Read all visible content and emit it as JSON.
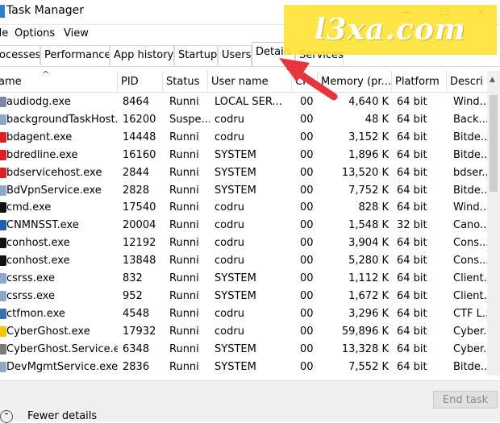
{
  "window": {
    "title": "Task Manager",
    "minimize": "—",
    "maximize": "☐",
    "close": "✕"
  },
  "menu": [
    {
      "label": "ile"
    },
    {
      "label": "Options"
    },
    {
      "label": "View"
    }
  ],
  "tabs": [
    {
      "label": "ocesses",
      "active": false
    },
    {
      "label": "Performance",
      "active": false
    },
    {
      "label": "App history",
      "active": false
    },
    {
      "label": "Startup",
      "active": false
    },
    {
      "label": "Users",
      "active": false
    },
    {
      "label": "Details",
      "active": true
    },
    {
      "label": "Services",
      "active": false
    }
  ],
  "watermark": "l3xa.com",
  "columns": [
    "ame",
    "PID",
    "Status",
    "User name",
    "CF",
    "Memory (pr...",
    "Platform",
    "Descri"
  ],
  "sort_indicator": "^",
  "rows": [
    {
      "name": "audiodg.exe",
      "pid": "8464",
      "status": "Runni",
      "user": "LOCAL SER...",
      "cpu": "00",
      "memory": "4,640 K",
      "platform": "64 bit",
      "desc": "Wind...",
      "icon": "audio-process-icon",
      "icon_color": "#7a8aa0"
    },
    {
      "name": "backgroundTaskHost.",
      "pid": "16200",
      "status": "Suspe...",
      "user": "codru",
      "cpu": "00",
      "memory": "48 K",
      "platform": "64 bit",
      "desc": "Back...",
      "icon": "window-icon",
      "icon_color": "#8fa8c8"
    },
    {
      "name": "bdagent.exe",
      "pid": "14448",
      "status": "Runni",
      "user": "codru",
      "cpu": "00",
      "memory": "3,152 K",
      "platform": "64 bit",
      "desc": "Bitde...",
      "icon": "bitdefender-icon",
      "icon_color": "#e02020"
    },
    {
      "name": "bdredline.exe",
      "pid": "16160",
      "status": "Runni",
      "user": "SYSTEM",
      "cpu": "00",
      "memory": "1,896 K",
      "platform": "64 bit",
      "desc": "Bitde...",
      "icon": "bitdefender-icon",
      "icon_color": "#e02020"
    },
    {
      "name": "bdservicehost.exe",
      "pid": "2844",
      "status": "Runni",
      "user": "SYSTEM",
      "cpu": "00",
      "memory": "13,520 K",
      "platform": "64 bit",
      "desc": "bdser...",
      "icon": "bitdefender-icon",
      "icon_color": "#e02020"
    },
    {
      "name": "BdVpnService.exe",
      "pid": "2828",
      "status": "Runni",
      "user": "SYSTEM",
      "cpu": "00",
      "memory": "7,752 K",
      "platform": "64 bit",
      "desc": "Bitde...",
      "icon": "window-icon",
      "icon_color": "#8fa8c8"
    },
    {
      "name": "cmd.exe",
      "pid": "17540",
      "status": "Runni",
      "user": "codru",
      "cpu": "00",
      "memory": "828 K",
      "platform": "64 bit",
      "desc": "Wind...",
      "icon": "console-icon",
      "icon_color": "#111111"
    },
    {
      "name": "CNMNSST.exe",
      "pid": "20004",
      "status": "Runni",
      "user": "codru",
      "cpu": "00",
      "memory": "1,548 K",
      "platform": "32 bit",
      "desc": "Cano...",
      "icon": "canon-icon",
      "icon_color": "#1a5fb4"
    },
    {
      "name": "conhost.exe",
      "pid": "12192",
      "status": "Runni",
      "user": "codru",
      "cpu": "00",
      "memory": "3,904 K",
      "platform": "64 bit",
      "desc": "Cons...",
      "icon": "console-icon",
      "icon_color": "#111111"
    },
    {
      "name": "conhost.exe",
      "pid": "13848",
      "status": "Runni",
      "user": "codru",
      "cpu": "00",
      "memory": "5,280 K",
      "platform": "64 bit",
      "desc": "Cons...",
      "icon": "console-icon",
      "icon_color": "#111111"
    },
    {
      "name": "csrss.exe",
      "pid": "832",
      "status": "Runni",
      "user": "SYSTEM",
      "cpu": "00",
      "memory": "1,112 K",
      "platform": "64 bit",
      "desc": "Client...",
      "icon": "window-icon",
      "icon_color": "#8fa8c8"
    },
    {
      "name": "csrss.exe",
      "pid": "952",
      "status": "Runni",
      "user": "SYSTEM",
      "cpu": "00",
      "memory": "1,672 K",
      "platform": "64 bit",
      "desc": "Client...",
      "icon": "window-icon",
      "icon_color": "#8fa8c8"
    },
    {
      "name": "ctfmon.exe",
      "pid": "4548",
      "status": "Runni",
      "user": "codru",
      "cpu": "00",
      "memory": "3,296 K",
      "platform": "64 bit",
      "desc": "CTF L...",
      "icon": "pen-icon",
      "icon_color": "#3a6fb0"
    },
    {
      "name": "CyberGhost.exe",
      "pid": "17932",
      "status": "Runni",
      "user": "codru",
      "cpu": "00",
      "memory": "59,896 K",
      "platform": "64 bit",
      "desc": "Cyber...",
      "icon": "cyberghost-icon",
      "icon_color": "#f5c400"
    },
    {
      "name": "CyberGhost.Service.e",
      "pid": "6348",
      "status": "Runni",
      "user": "SYSTEM",
      "cpu": "00",
      "memory": "13,328 K",
      "platform": "64 bit",
      "desc": "Cyber...",
      "icon": "gear-icon",
      "icon_color": "#7a7a7a"
    },
    {
      "name": "DevMgmtService.exe",
      "pid": "2836",
      "status": "Runni",
      "user": "SYSTEM",
      "cpu": "00",
      "memory": "7,552 K",
      "platform": "64 bit",
      "desc": "Bitde...",
      "icon": "window-icon",
      "icon_color": "#8fa8c8"
    }
  ],
  "footer": {
    "fewer_details": "Fewer details",
    "fewer_icon": "⌃",
    "end_task": "End task"
  },
  "colors": {
    "arrow": "#e8343b",
    "watermark_bg": "#ffe433",
    "accent": "#2d7dd2"
  }
}
